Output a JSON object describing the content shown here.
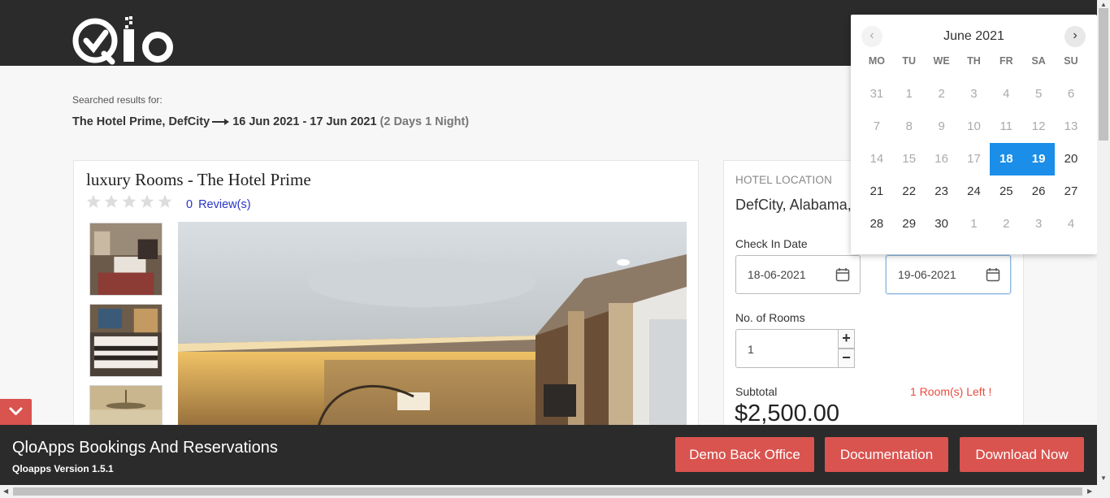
{
  "header": {
    "logo_text": "Qlo"
  },
  "search": {
    "label": "Searched results for:",
    "hotel": "The Hotel Prime, DefCity",
    "dates": "16 Jun 2021 - 17 Jun 2021",
    "duration": "(2 Days 1 Night)"
  },
  "product": {
    "title": "luxury Rooms - The Hotel Prime",
    "review_count": "0",
    "review_label": "Review(s)",
    "rating": 0,
    "max_rating": 5
  },
  "booking": {
    "location_label": "HOTEL LOCATION",
    "location_value": "DefCity, Alabama,",
    "checkin_label": "Check In Date",
    "checkin_value": "18-06-2021",
    "checkout_value": "19-06-2021",
    "rooms_label": "No. of Rooms",
    "rooms_value": "1",
    "plus": "+",
    "minus": "−",
    "subtotal_label": "Subtotal",
    "rooms_left": "1 Room(s) Left !",
    "price": "$2,500.00"
  },
  "calendar": {
    "month": "June 2021",
    "prev": "‹",
    "next": "›",
    "weekdays": [
      "MO",
      "TU",
      "WE",
      "TH",
      "FR",
      "SA",
      "SU"
    ],
    "weeks": [
      [
        "31",
        "1",
        "2",
        "3",
        "4",
        "5",
        "6"
      ],
      [
        "7",
        "8",
        "9",
        "10",
        "11",
        "12",
        "13"
      ],
      [
        "14",
        "15",
        "16",
        "17",
        "18",
        "19",
        "20"
      ],
      [
        "21",
        "22",
        "23",
        "24",
        "25",
        "26",
        "27"
      ],
      [
        "28",
        "29",
        "30",
        "1",
        "2",
        "3",
        "4"
      ]
    ],
    "selected_color": "#1a8ee8"
  },
  "footer": {
    "title": "QloApps Bookings And Reservations",
    "version": "Qloapps Version 1.5.1",
    "buttons": [
      "Demo Back Office",
      "Documentation",
      "Download Now"
    ],
    "accent": "#d9534f"
  }
}
